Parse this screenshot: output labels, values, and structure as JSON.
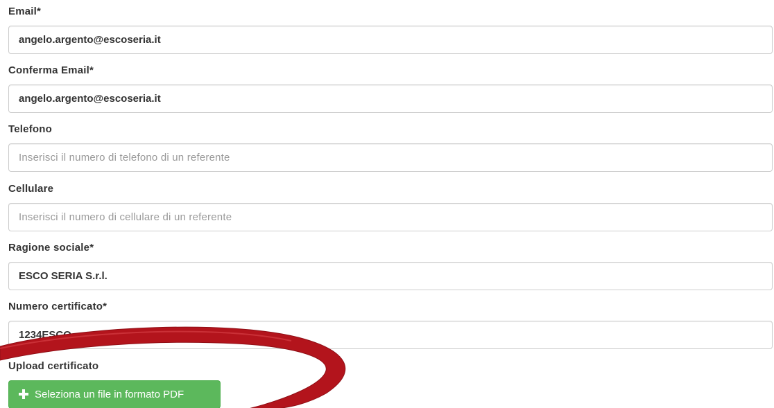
{
  "form": {
    "fields": [
      {
        "label": "Email*",
        "value": "angelo.argento@escoseria.it",
        "placeholder": ""
      },
      {
        "label": "Conferma Email*",
        "value": "angelo.argento@escoseria.it",
        "placeholder": ""
      },
      {
        "label": "Telefono",
        "value": "",
        "placeholder": "Inserisci il numero di telefono di un referente"
      },
      {
        "label": "Cellulare",
        "value": "",
        "placeholder": "Inserisci il numero di cellulare di un referente"
      },
      {
        "label": "Ragione sociale*",
        "value": "ESCO SERIA S.r.l.",
        "placeholder": ""
      },
      {
        "label": "Numero certificato*",
        "value": "1234ESCO",
        "placeholder": ""
      }
    ],
    "upload": {
      "label": "Upload certificato",
      "button_label": "Seleziona un file in formato PDF",
      "icon": "plus-icon"
    }
  },
  "colors": {
    "label_text": "#333333",
    "input_border": "#cccccc",
    "placeholder": "#999999",
    "upload_button": "#5cb85c",
    "annotation_stroke": "#b3141c"
  }
}
